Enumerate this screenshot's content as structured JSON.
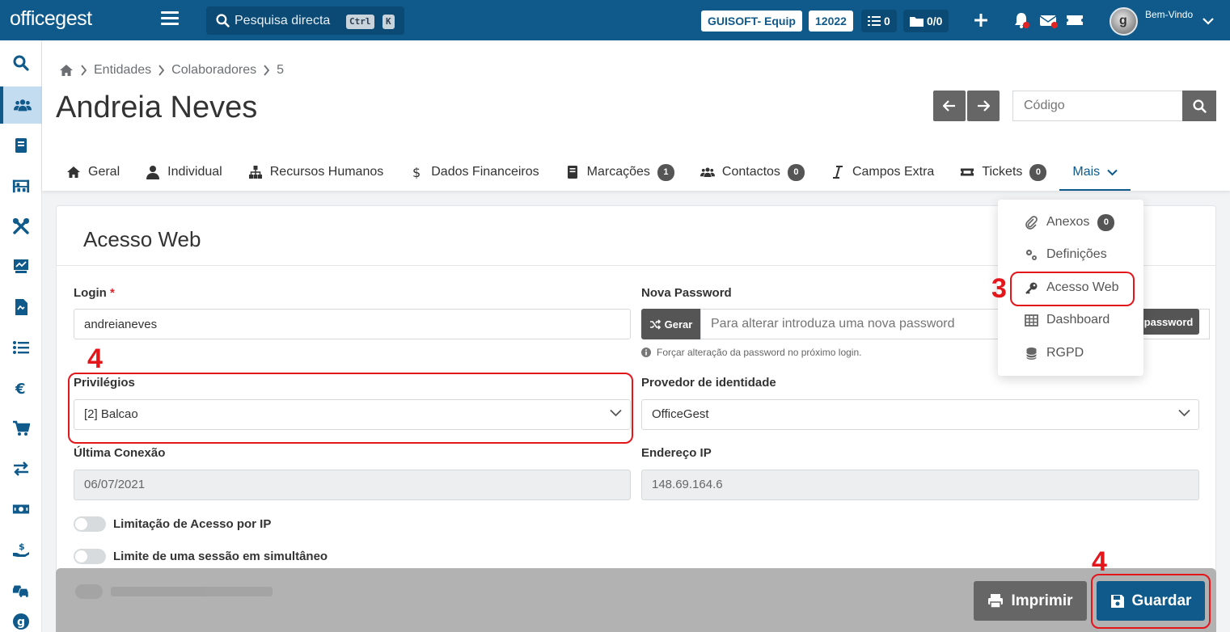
{
  "topbar": {
    "logo": "officegest",
    "search_placeholder": "Pesquisa directa",
    "kbd_ctrl": "Ctrl",
    "kbd_k": "K",
    "company": "GUISOFT- Equip",
    "number": "12022",
    "tasks_count": "0",
    "docs_count": "0/0",
    "welcome": "Bem-Vindo",
    "avatar_letter": "g"
  },
  "breadcrumb": {
    "items": [
      "Entidades",
      "Colaboradores",
      "5"
    ]
  },
  "page": {
    "title": "Andreia Neves",
    "code_placeholder": "Código"
  },
  "tabs": [
    {
      "label": "Geral"
    },
    {
      "label": "Individual"
    },
    {
      "label": "Recursos Humanos"
    },
    {
      "label": "Dados Financeiros"
    },
    {
      "label": "Marcações",
      "badge": "1"
    },
    {
      "label": "Contactos",
      "badge": "0"
    },
    {
      "label": "Campos Extra"
    },
    {
      "label": "Tickets",
      "badge": "0"
    },
    {
      "label": "Mais"
    }
  ],
  "dropdown": {
    "items": [
      {
        "label": "Anexos",
        "badge": "0"
      },
      {
        "label": "Definições"
      },
      {
        "label": "Acesso Web"
      },
      {
        "label": "Dashboard"
      },
      {
        "label": "RGPD"
      }
    ]
  },
  "form": {
    "section_title": "Acesso Web",
    "login_label": "Login",
    "login_required": "*",
    "login_value": "andreianeves",
    "new_password_label": "Nova Password",
    "gerar_label": "Gerar",
    "password_placeholder": "Para alterar introduza uma nova password",
    "password_btn_label": "password",
    "force_change_hint": "Forçar alteração da password no próximo login.",
    "privileges_label": "Privilégios",
    "privileges_value": "[2] Balcao",
    "identity_provider_label": "Provedor de identidade",
    "identity_provider_value": "OfficeGest",
    "last_connection_label": "Última Conexão",
    "last_connection_value": "06/07/2021",
    "ip_label": "Endereço IP",
    "ip_value": "148.69.164.6",
    "ip_limit_label": "Limitação de Acesso por IP",
    "single_session_label": "Limite de uma sessão em simultâneo"
  },
  "footer": {
    "print_label": "Imprimir",
    "save_label": "Guardar"
  },
  "annotations": {
    "step3": "3",
    "step4a": "4",
    "step4b": "4"
  },
  "colors": {
    "brand": "#0f5a8a",
    "annotation": "#e3161c",
    "sidebar_active": "#c4dcf0"
  }
}
